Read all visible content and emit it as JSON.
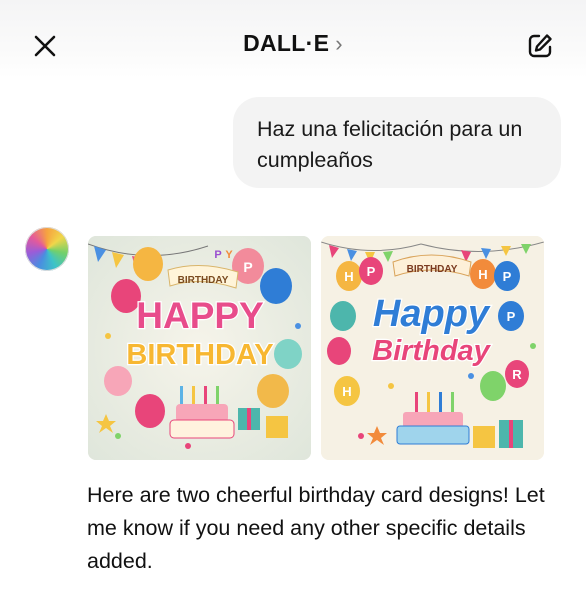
{
  "header": {
    "title": "DALL·E",
    "chevron": "›",
    "close_icon": "close-icon",
    "edit_icon": "edit-icon"
  },
  "messages": {
    "user_text": "Haz una felicitación para un cumpleaños",
    "assistant_reply": "Here are two cheerful birthday card designs! Let me know if you need any other specific details added."
  },
  "images": [
    {
      "banner": "BIRTHDAY",
      "line1": "HAPPY",
      "line2": "BIRTHDAY",
      "balloon_letters": [
        "P",
        "P",
        "Y"
      ]
    },
    {
      "banner": "BIRTHDAY",
      "line1": "Happy",
      "line2": "Birthday",
      "balloon_letters": [
        "H",
        "P",
        "H",
        "P",
        "P",
        "H",
        "R"
      ]
    }
  ]
}
